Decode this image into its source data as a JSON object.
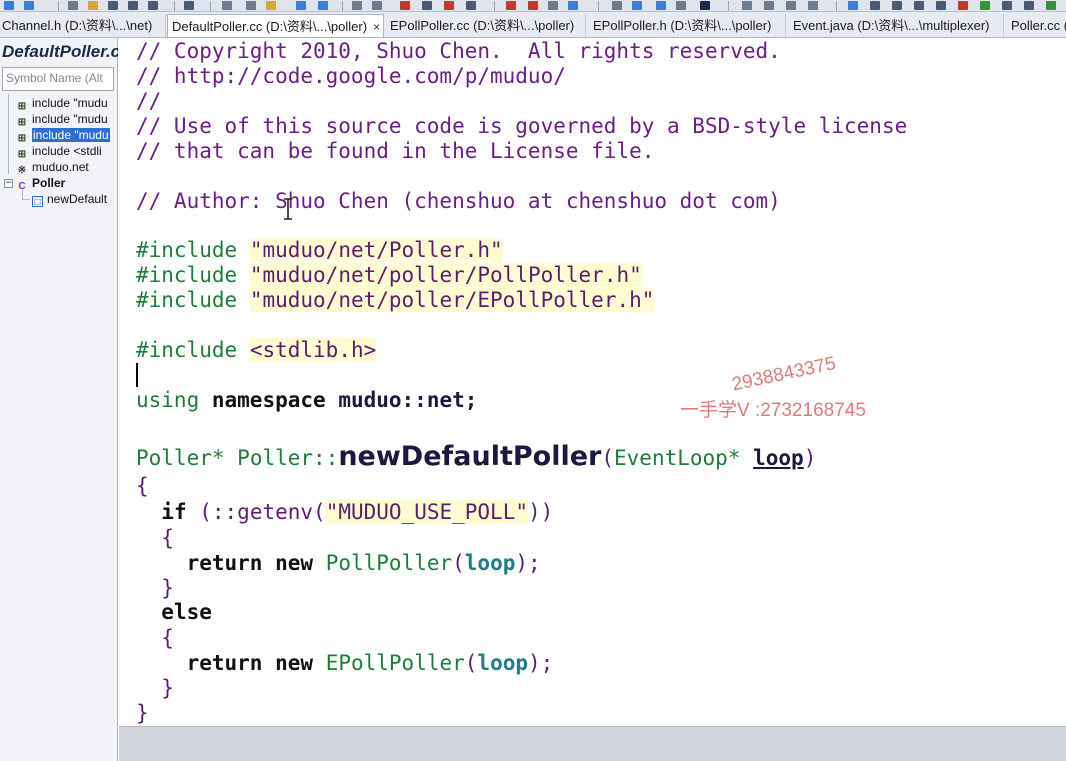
{
  "tabs": [
    {
      "label": "Channel.h (D:\\资料\\...\\net)",
      "active": false
    },
    {
      "label": "DefaultPoller.cc (D:\\资料\\...\\poller)",
      "active": true,
      "close": "×"
    },
    {
      "label": "EPollPoller.cc (D:\\资料\\...\\poller)",
      "active": false
    },
    {
      "label": "EPollPoller.h (D:\\资料\\...\\poller)",
      "active": false
    },
    {
      "label": "Event.java (D:\\资料\\...\\multiplexer)",
      "active": false
    },
    {
      "label": "Poller.cc (",
      "active": false
    }
  ],
  "symbol_window": {
    "title": "DefaultPoller.cc",
    "search_placeholder": "Symbol Name (Alt",
    "items": [
      {
        "label": "include \"mudu",
        "icon": "include-icon",
        "selected": false
      },
      {
        "label": "include \"mudu",
        "icon": "include-icon",
        "selected": false
      },
      {
        "label": "include \"mudu",
        "icon": "include-icon",
        "selected": true
      },
      {
        "label": "include <stdli",
        "icon": "include-icon",
        "selected": false
      },
      {
        "label": "muduo.net",
        "icon": "namespace-icon",
        "selected": false
      },
      {
        "label": "Poller",
        "icon": "class-icon",
        "selected": false
      },
      {
        "label": "newDefault",
        "icon": "function-icon",
        "selected": false
      }
    ]
  },
  "code": {
    "l1": "// Copyright 2010, Shuo Chen.  All rights reserved.",
    "l2": "// http://code.google.com/p/muduo/",
    "l3": "//",
    "l4": "// Use of this source code is governed by a BSD-style license",
    "l5": "// that can be found in the License file.",
    "l7": "// Author: Shuo Chen (chenshuo at chenshuo dot com)",
    "inc_kw": "#include",
    "inc1": "\"muduo/net/Poller.h\"",
    "inc2": "\"muduo/net/poller/PollPoller.h\"",
    "inc3": "\"muduo/net/poller/EPollPoller.h\"",
    "inc4": "<stdlib.h>",
    "using": "using",
    "namespace": "namespace",
    "ns_name": "muduo::net;",
    "ret_type": "Poller*",
    "scope": "Poller::",
    "func_name": "newDefaultPoller",
    "lparen": "(",
    "param_type": "EventLoop*",
    "param_name": "loop",
    "rparen": ")",
    "lbrace": "{",
    "rbrace": "}",
    "if_kw": "if",
    "getenv_pre": "(::getenv(",
    "env_str": "\"MUDUO_USE_POLL\"",
    "getenv_post": "))",
    "return_kw": "return",
    "new_kw": "new",
    "poll_cls": "PollPoller",
    "epoll_cls": "EPollPoller",
    "call_open": "(",
    "arg": "loop",
    "call_close": ");",
    "else_kw": "else"
  },
  "watermark": {
    "line1": "2938843375",
    "line2": "一手学V :2732168745"
  },
  "colors": {
    "comment": "#6a1f86",
    "preprocessor": "#1f7d3a",
    "string_bg": "#fdfbd0",
    "selection": "#2c6fd1",
    "watermark": "#cd2828"
  }
}
